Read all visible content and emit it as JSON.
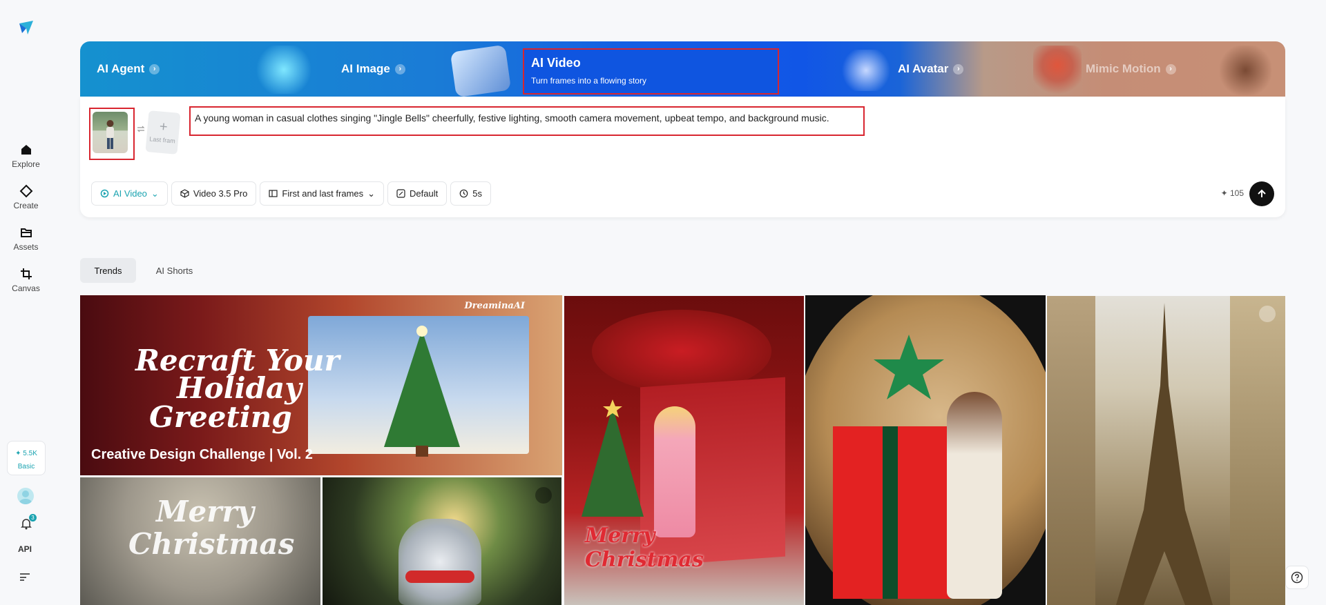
{
  "sidebar": {
    "items": [
      {
        "label": "Explore",
        "icon": "home-icon"
      },
      {
        "label": "Create",
        "icon": "diamond-icon"
      },
      {
        "label": "Assets",
        "icon": "folder-icon"
      },
      {
        "label": "Canvas",
        "icon": "crop-icon"
      }
    ],
    "credits": "5.5K",
    "plan": "Basic",
    "notifications": "3",
    "api": "API"
  },
  "banner": {
    "tabs": [
      {
        "label": "AI Agent"
      },
      {
        "label": "AI Image"
      },
      {
        "label": "AI Video",
        "subtitle": "Turn frames into a flowing story"
      },
      {
        "label": "AI Avatar"
      },
      {
        "label": "Mimic Motion"
      }
    ]
  },
  "composer": {
    "last_frame_label": "Last fram",
    "prompt": "A young woman in casual clothes singing \"Jingle Bells\" cheerfully, festive lighting, smooth camera movement, upbeat tempo, and background music.",
    "toolbar": {
      "mode": "AI Video",
      "model": "Video 3.5 Pro",
      "frames": "First and last frames",
      "ratio": "Default",
      "duration": "5s"
    },
    "cost": "105"
  },
  "gallery": {
    "tabs": [
      "Trends",
      "AI Shorts"
    ],
    "featured_title": "Creative Design Challenge | Vol. 2",
    "featured_brand": "DreaminaAI",
    "featured_script": [
      "Recraft Your",
      "Holiday",
      "Greeting"
    ],
    "card2_script": [
      "Merry",
      "Christmas"
    ],
    "card4_script": [
      "Merry",
      "Christmas"
    ]
  }
}
